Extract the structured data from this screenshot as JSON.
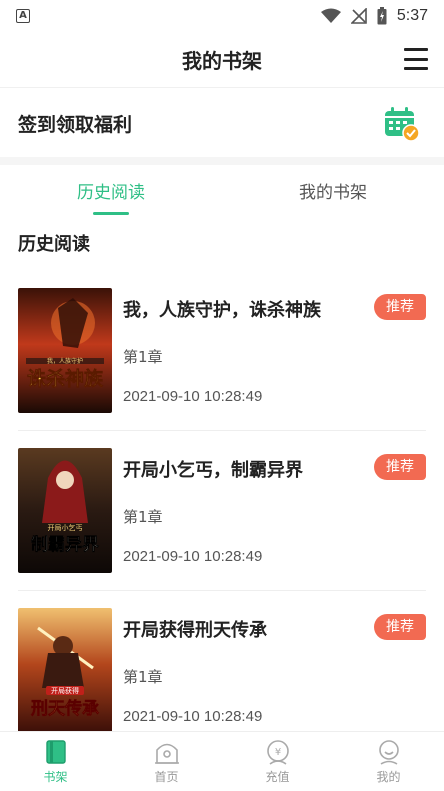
{
  "status_bar": {
    "left_icon": "A",
    "time": "5:37",
    "icons": [
      "wifi-icon",
      "signal-off-icon",
      "battery-charging-icon"
    ]
  },
  "header": {
    "title": "我的书架",
    "menu_icon": "menu-icon"
  },
  "signin": {
    "label": "签到领取福利",
    "icon": "calendar-check-icon"
  },
  "tabs": [
    {
      "label": "历史阅读",
      "active": true
    },
    {
      "label": "我的书架",
      "active": false
    }
  ],
  "section_title": "历史阅读",
  "books": [
    {
      "title": "我，人族守护，诛杀神族",
      "chapter": "第1章",
      "time": "2021-09-10 10:28:49",
      "tag": "推荐",
      "cover_text": "诛杀神族",
      "cover_subtext": "我，人族守护"
    },
    {
      "title": "开局小乞丐，制霸异界",
      "chapter": "第1章",
      "time": "2021-09-10 10:28:49",
      "tag": "推荐",
      "cover_text": "制霸异界",
      "cover_subtext": "开局小乞丐"
    },
    {
      "title": "开局获得刑天传承",
      "chapter": "第1章",
      "time": "2021-09-10 10:28:49",
      "tag": "推荐",
      "cover_text": "刑天传承",
      "cover_subtext": "开局获得"
    }
  ],
  "bottom_nav": [
    {
      "label": "书架",
      "icon": "bookshelf-icon",
      "active": true
    },
    {
      "label": "首页",
      "icon": "home-icon",
      "active": false
    },
    {
      "label": "充值",
      "icon": "recharge-icon",
      "active": false
    },
    {
      "label": "我的",
      "icon": "profile-icon",
      "active": false
    }
  ],
  "colors": {
    "accent": "#2fbf86",
    "tag": "#f26a52",
    "calendar": "#2fbf86",
    "calendar_check": "#f5a623"
  }
}
